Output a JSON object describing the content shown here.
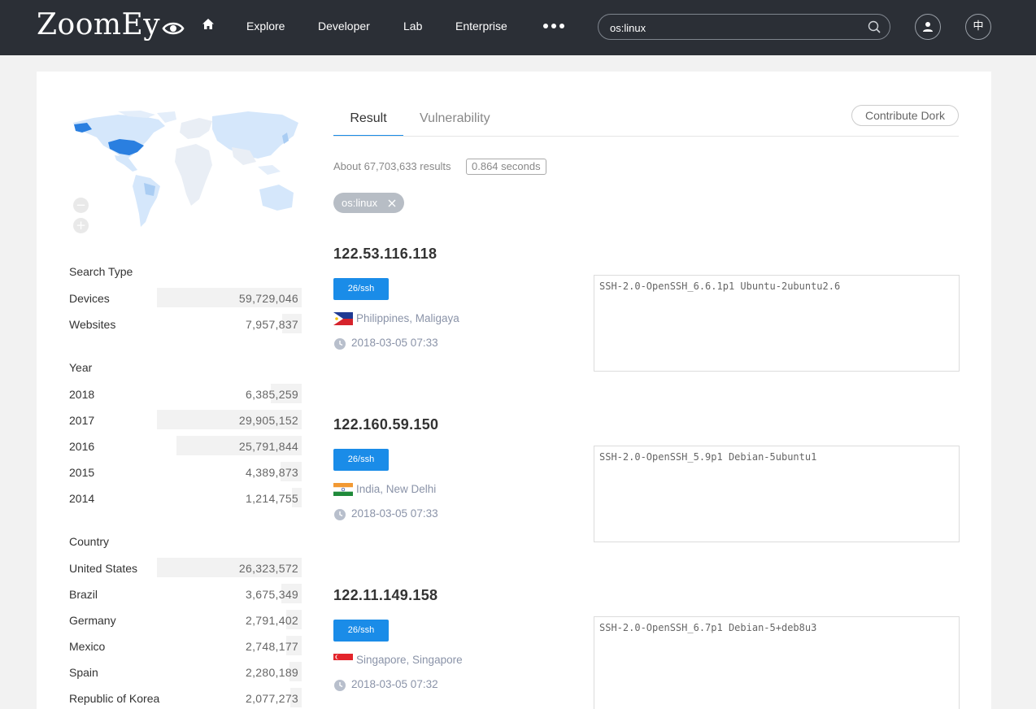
{
  "header": {
    "logo_text": "ZoomEy",
    "nav": [
      "Explore",
      "Developer",
      "Lab",
      "Enterprise"
    ],
    "search_value": "os:linux",
    "lang_label": "中"
  },
  "sidebar": {
    "search_type": {
      "title": "Search Type",
      "items": [
        {
          "label": "Devices",
          "count": "59,729,046",
          "value": 59729046
        },
        {
          "label": "Websites",
          "count": "7,957,837",
          "value": 7957837
        }
      ]
    },
    "year": {
      "title": "Year",
      "items": [
        {
          "label": "2018",
          "count": "6,385,259",
          "value": 6385259
        },
        {
          "label": "2017",
          "count": "29,905,152",
          "value": 29905152
        },
        {
          "label": "2016",
          "count": "25,791,844",
          "value": 25791844
        },
        {
          "label": "2015",
          "count": "4,389,873",
          "value": 4389873
        },
        {
          "label": "2014",
          "count": "1,214,755",
          "value": 1214755
        }
      ]
    },
    "country": {
      "title": "Country",
      "items": [
        {
          "label": "United States",
          "count": "26,323,572",
          "value": 26323572
        },
        {
          "label": "Brazil",
          "count": "3,675,349",
          "value": 3675349
        },
        {
          "label": "Germany",
          "count": "2,791,402",
          "value": 2791402
        },
        {
          "label": "Mexico",
          "count": "2,748,177",
          "value": 2748177
        },
        {
          "label": "Spain",
          "count": "2,280,189",
          "value": 2280189
        },
        {
          "label": "Republic of Korea",
          "count": "2,077,273",
          "value": 2077273
        }
      ]
    }
  },
  "tabs": {
    "result": "Result",
    "vulnerability": "Vulnerability",
    "contribute": "Contribute Dork"
  },
  "summary": {
    "text": "About 67,703,633 results",
    "time": "0.864 seconds"
  },
  "filter_chip": "os:linux",
  "results": [
    {
      "ip": "122.53.116.118",
      "port": "26/ssh",
      "location": "Philippines, Maligaya",
      "timestamp": "2018-03-05 07:33",
      "banner": "SSH-2.0-OpenSSH_6.6.1p1 Ubuntu-2ubuntu2.6"
    },
    {
      "ip": "122.160.59.150",
      "port": "26/ssh",
      "location": "India, New Delhi",
      "timestamp": "2018-03-05 07:33",
      "banner": "SSH-2.0-OpenSSH_5.9p1 Debian-5ubuntu1"
    },
    {
      "ip": "122.11.149.158",
      "port": "26/ssh",
      "location": "Singapore, Singapore",
      "timestamp": "2018-03-05 07:32",
      "banner": "SSH-2.0-OpenSSH_6.7p1 Debian-5+deb8u3"
    }
  ],
  "colors": {
    "header_bg": "#2b2f36",
    "accent": "#1a8ce8",
    "map_highlight": "#2a7fe0",
    "map_light": "#d5e7fb"
  }
}
